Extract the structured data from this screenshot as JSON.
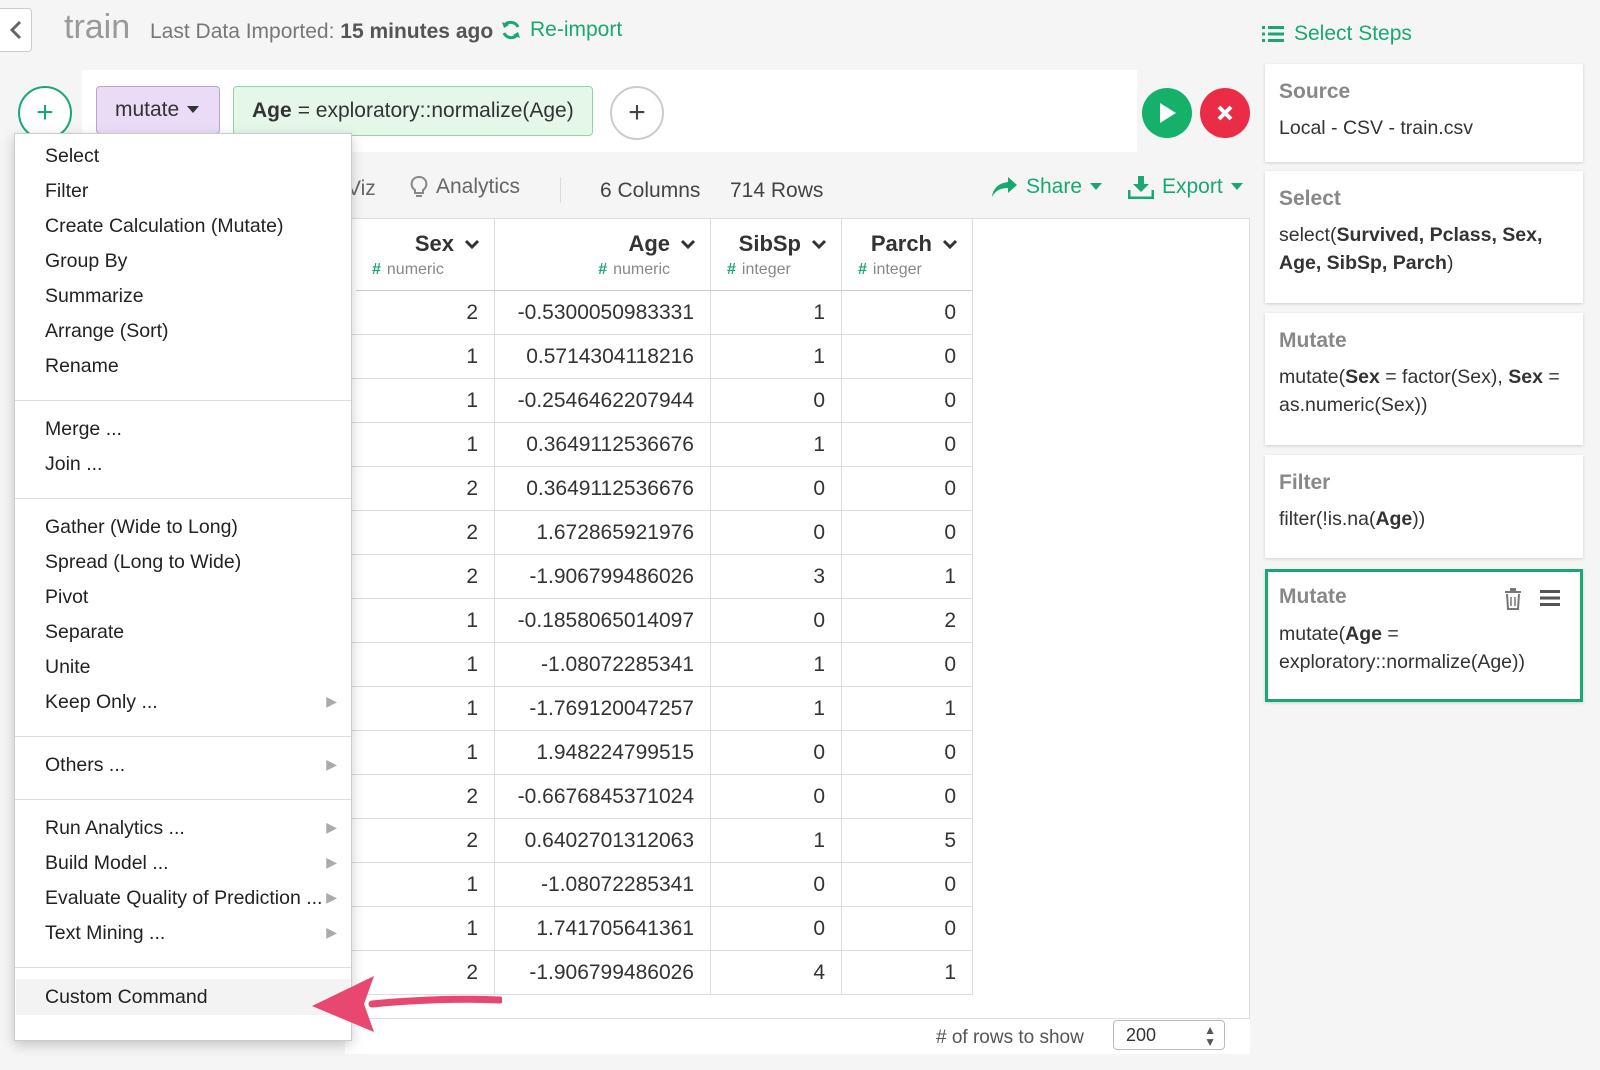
{
  "header": {
    "back_icon": "chevron-left-icon",
    "dataset_title": "train",
    "last_import_label": "Last Data Imported:",
    "last_import_value": "15 minutes ago",
    "reimport_label": "Re-import",
    "select_steps_label": "Select Steps"
  },
  "command": {
    "command_name": "mutate",
    "expr_column": "Age",
    "expr_rest": "= exploratory::normalize(Age)"
  },
  "toolbar": {
    "viz_tab": "Viz",
    "analytics_tab": "Analytics",
    "columns_count": "6 Columns",
    "rows_count": "714 Rows",
    "share_label": "Share",
    "export_label": "Export"
  },
  "table": {
    "columns": [
      {
        "name": "Sex",
        "type": "numeric"
      },
      {
        "name": "Age",
        "type": "numeric"
      },
      {
        "name": "SibSp",
        "type": "integer"
      },
      {
        "name": "Parch",
        "type": "integer"
      }
    ],
    "rows": [
      [
        "2",
        "-0.5300050983331",
        "1",
        "0"
      ],
      [
        "1",
        "0.5714304118216",
        "1",
        "0"
      ],
      [
        "1",
        "-0.2546462207944",
        "0",
        "0"
      ],
      [
        "1",
        "0.3649112536676",
        "1",
        "0"
      ],
      [
        "2",
        "0.3649112536676",
        "0",
        "0"
      ],
      [
        "2",
        "1.672865921976",
        "0",
        "0"
      ],
      [
        "2",
        "-1.906799486026",
        "3",
        "1"
      ],
      [
        "1",
        "-0.1858065014097",
        "0",
        "2"
      ],
      [
        "1",
        "-1.08072285341",
        "1",
        "0"
      ],
      [
        "1",
        "-1.769120047257",
        "1",
        "1"
      ],
      [
        "1",
        "1.948224799515",
        "0",
        "0"
      ],
      [
        "2",
        "-0.6676845371024",
        "0",
        "0"
      ],
      [
        "2",
        "0.6402701312063",
        "1",
        "5"
      ],
      [
        "1",
        "-1.08072285341",
        "0",
        "0"
      ],
      [
        "1",
        "1.741705641361",
        "0",
        "0"
      ],
      [
        "2",
        "-1.906799486026",
        "4",
        "1"
      ]
    ],
    "rows_to_show_label": "# of rows to show",
    "rows_to_show_value": "200"
  },
  "menu": {
    "group1": [
      "Select",
      "Filter",
      "Create Calculation (Mutate)",
      "Group By",
      "Summarize",
      "Arrange (Sort)",
      "Rename"
    ],
    "group2": [
      "Merge ...",
      "Join ..."
    ],
    "group3": [
      "Gather (Wide to Long)",
      "Spread (Long to Wide)",
      "Pivot",
      "Separate",
      "Unite",
      "Keep Only ..."
    ],
    "group4": [
      "Others ..."
    ],
    "group5": [
      "Run Analytics ...",
      "Build Model ...",
      "Evaluate Quality of Prediction ...",
      "Text Mining ..."
    ],
    "group6": [
      "Custom Command"
    ]
  },
  "steps": [
    {
      "title": "Source",
      "body": "Local - CSV - train.csv"
    },
    {
      "title": "Select",
      "body_prefix": "select(",
      "body_bold": "Survived, Pclass, Sex, Age, SibSp, Parch",
      "body_suffix": ")"
    },
    {
      "title": "Mutate",
      "p1": "mutate(",
      "b1": "Sex",
      "p2": " = factor(Sex), ",
      "b2": "Sex",
      "p3": " = as.numeric(Sex))"
    },
    {
      "title": "Filter",
      "p1": "filter(!is.na(",
      "b1": "Age",
      "p2": "))"
    },
    {
      "title": "Mutate",
      "p1": "mutate(",
      "b1": "Age",
      "p2": " = exploratory::normalize(Age))"
    }
  ],
  "colors": {
    "accent": "#1aa872",
    "run": "#15b06a",
    "cancel": "#ea2c47",
    "command_bg": "#eadcf7",
    "expr_bg": "#e4f7e9",
    "arrow": "#e8476f"
  }
}
